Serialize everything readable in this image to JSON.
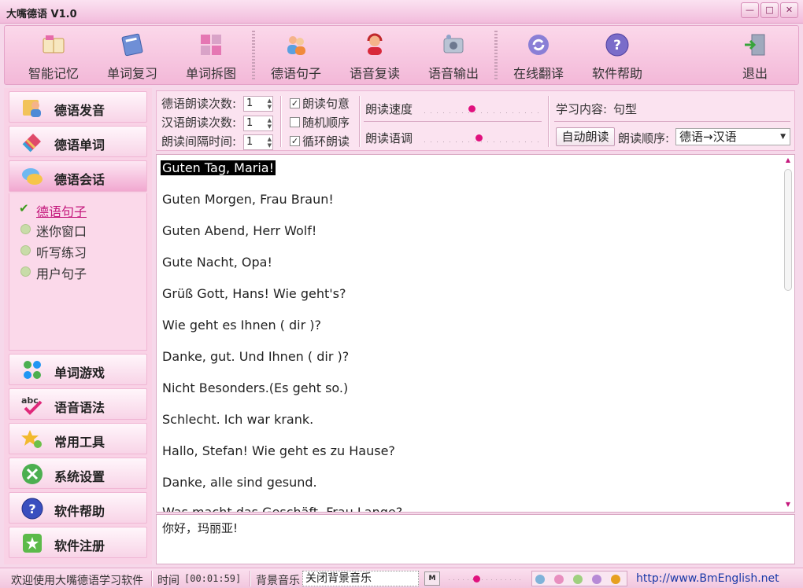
{
  "window": {
    "title": "大嘴德语 V1.0",
    "min": "—",
    "max": "□",
    "close": "✕"
  },
  "toolbar": {
    "items": [
      {
        "label": "智能记忆",
        "icon": "book-icon"
      },
      {
        "label": "单词复习",
        "icon": "notebook-icon"
      },
      {
        "label": "单词拆图",
        "icon": "grid-icon"
      },
      {
        "label": "德语句子",
        "icon": "people-icon"
      },
      {
        "label": "语音复读",
        "icon": "headset-person-icon"
      },
      {
        "label": "语音输出",
        "icon": "speaker-icon"
      },
      {
        "label": "在线翻译",
        "icon": "refresh-icon"
      },
      {
        "label": "软件帮助",
        "icon": "help-icon"
      },
      {
        "label": "退出",
        "icon": "exit-door-icon"
      }
    ]
  },
  "sidebar": {
    "top": [
      {
        "label": "德语发音",
        "icon": "pronunciation-icon"
      },
      {
        "label": "德语单词",
        "icon": "words-icon"
      },
      {
        "label": "德语会话",
        "icon": "chat-bubble-icon"
      }
    ],
    "sub": [
      "德语句子",
      "迷你窗口",
      "听写练习",
      "用户句子"
    ],
    "bottom": [
      {
        "label": "单词游戏",
        "icon": "game-icon"
      },
      {
        "label": "语音语法",
        "icon": "abc-check-icon"
      },
      {
        "label": "常用工具",
        "icon": "tools-icon"
      },
      {
        "label": "系统设置",
        "icon": "wrench-icon"
      },
      {
        "label": "软件帮助",
        "icon": "question-icon"
      },
      {
        "label": "软件注册",
        "icon": "register-star-icon"
      }
    ]
  },
  "controls": {
    "de_count_label": "德语朗读次数:",
    "de_count": "1",
    "cn_count_label": "汉语朗读次数:",
    "cn_count": "1",
    "interval_label": "朗读间隔时间:",
    "interval": "1",
    "cb_meaning": "朗读句意",
    "cb_meaning_checked": true,
    "cb_random": "随机顺序",
    "cb_random_checked": false,
    "cb_loop": "循环朗读",
    "cb_loop_checked": true,
    "speed_label": "朗读速度",
    "speed_level": 0.4,
    "tone_label": "朗读语调",
    "tone_level": 0.47,
    "content_label": "学习内容:",
    "content_value": "句型",
    "auto_read": "自动朗读",
    "order_label": "朗读顺序:",
    "order_value": "德语→汉语"
  },
  "sentences": [
    "Guten Tag, Maria!",
    "Guten Morgen, Frau Braun!",
    "Guten Abend, Herr Wolf!",
    "Gute Nacht, Opa!",
    "Grüß Gott, Hans! Wie geht's?",
    "Wie geht es Ihnen ( dir )?",
    "Danke, gut. Und Ihnen ( dir )?",
    "Nicht Besonders.(Es geht so.)",
    "Schlecht. Ich war krank.",
    "Hallo, Stefan! Wie geht es zu Hause?",
    "Danke, alle sind gesund.",
    "Was macht das Geschäft, Frau Lange?"
  ],
  "translation": "你好，玛丽亚!",
  "status": {
    "welcome": "欢迎使用大嘴德语学习软件",
    "time_label": "时间",
    "time_value": "[00:01:59]",
    "music_label": "背景音乐",
    "music_value": "关闭背景音乐",
    "music_btn": "M",
    "volume_level": 0.36,
    "color_dots": [
      "#7fb3d9",
      "#e88fbf",
      "#9fd07f",
      "#b78ad6",
      "#e6a020"
    ],
    "url": "http://www.BmEnglish.net"
  }
}
